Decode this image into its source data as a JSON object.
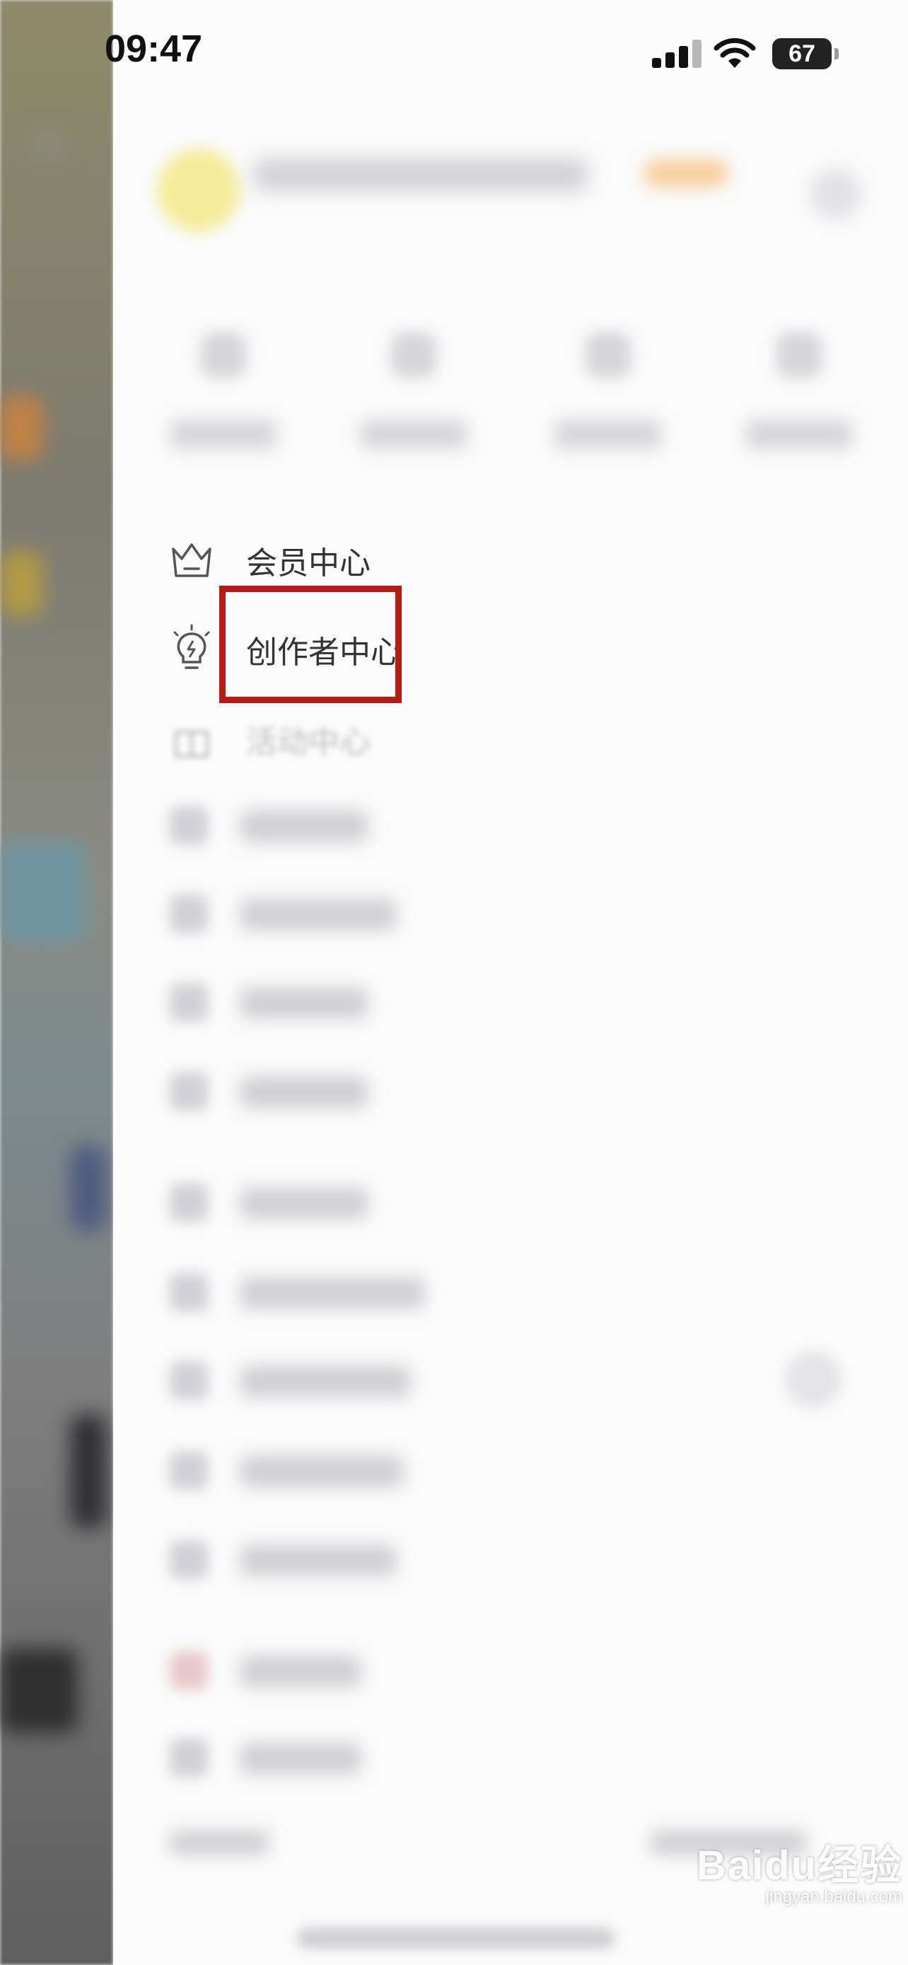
{
  "status_bar": {
    "time": "09:47",
    "battery": "67"
  },
  "menu": {
    "items": [
      {
        "label": "会员中心",
        "icon": "crown-icon"
      },
      {
        "label": "创作者中心",
        "icon": "lightbulb-icon"
      },
      {
        "label": "活动中心",
        "icon": "gift-icon"
      }
    ]
  },
  "watermark": {
    "main": "Baidu经验",
    "sub": "jingyan.baidu.com"
  },
  "colors": {
    "highlight": "#b81a14",
    "drawer_bg": "#fbfbfb",
    "text": "#333333"
  }
}
